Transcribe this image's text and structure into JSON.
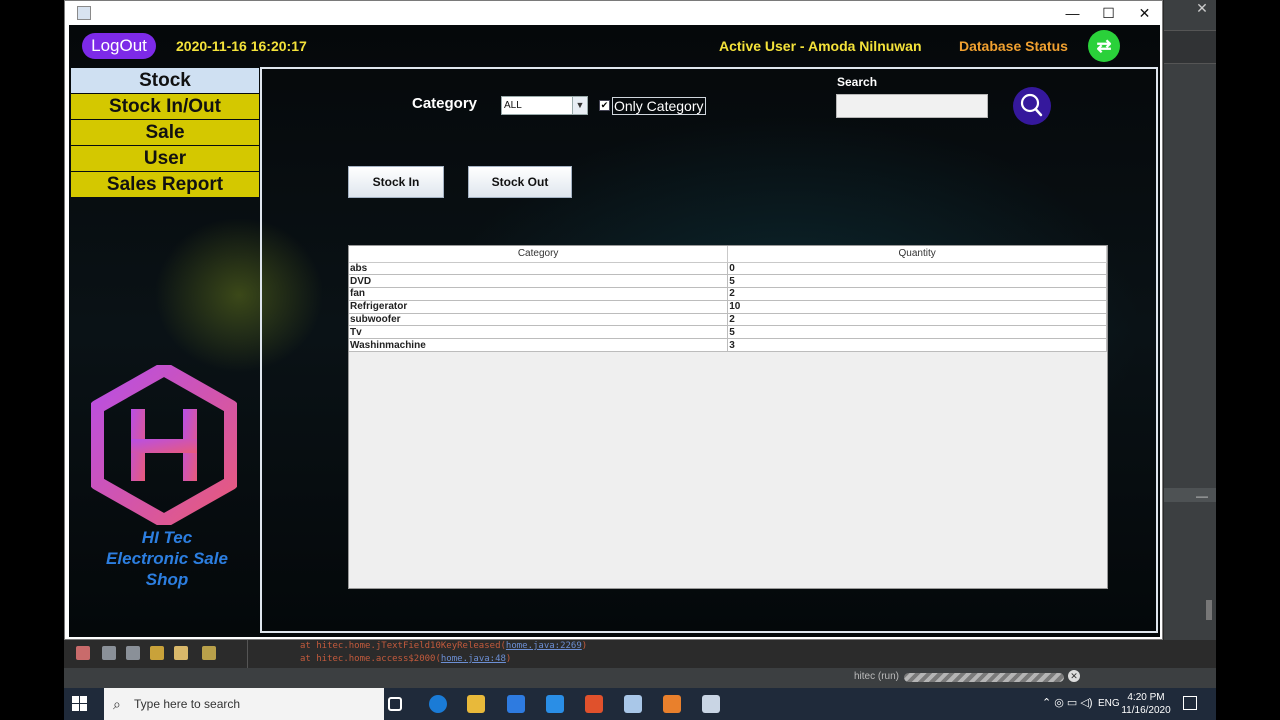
{
  "window": {
    "minimize": "—",
    "maximize": "☐",
    "close": "✕"
  },
  "header": {
    "logout_label": "LogOut",
    "datetime": "2020-11-16 16:20:17",
    "active_user": "Active User - Amoda Nilnuwan",
    "db_status_label": "Database Status",
    "db_status_icon": "⇄",
    "db_status_color": "#2ad13a"
  },
  "sidebar": {
    "items": [
      {
        "label": "Stock",
        "active": true
      },
      {
        "label": "Stock In/Out"
      },
      {
        "label": "Sale"
      },
      {
        "label": "User"
      },
      {
        "label": "Sales Report"
      }
    ],
    "brand_line1": "HI Tec",
    "brand_line2": "Electronic Sale",
    "brand_line3": "Shop"
  },
  "filters": {
    "category_label": "Category",
    "category_value": "ALL",
    "only_category_label": "Only Category",
    "only_category_checked": true,
    "search_label": "Search",
    "search_value": ""
  },
  "actions": {
    "stock_in": "Stock In",
    "stock_out": "Stock Out"
  },
  "table": {
    "columns": [
      "Category",
      "Quantity"
    ],
    "rows": [
      [
        "abs",
        "0"
      ],
      [
        "DVD",
        "5"
      ],
      [
        "fan",
        "2"
      ],
      [
        "Refrigerator",
        "10"
      ],
      [
        "subwoofer",
        "2"
      ],
      [
        "Tv",
        "5"
      ],
      [
        "Washinmachine",
        "3"
      ]
    ]
  },
  "console": {
    "line1_prefix": "at hitec.home.jTextField10KeyReleased(",
    "line1_link": "home.java:2269",
    "line1_suffix": ")",
    "line2_prefix": "at hitec.home.access$2000(",
    "line2_link": "home.java:48",
    "line2_suffix": ")",
    "run_label": "hitec (run)"
  },
  "ide": {
    "panel_minimize": "—"
  },
  "taskbar": {
    "search_placeholder": "Type here to search",
    "language": "ENG",
    "time": "4:20 PM",
    "date": "11/16/2020"
  }
}
